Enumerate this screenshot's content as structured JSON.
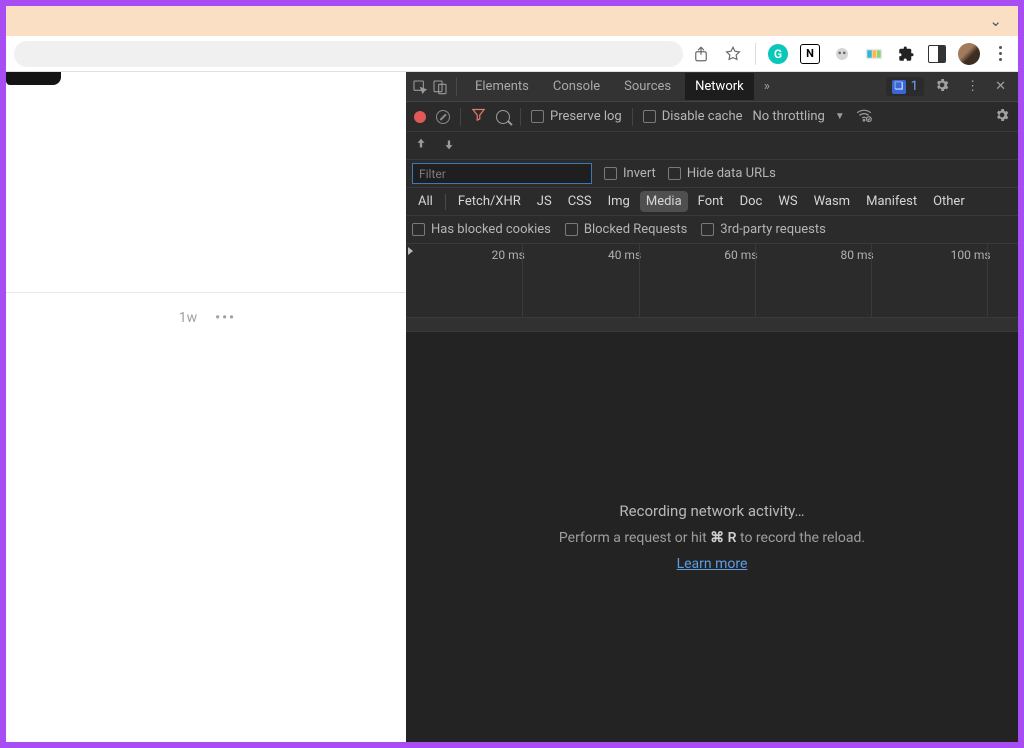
{
  "browser": {
    "share_label": "Share",
    "star_label": "Bookmark"
  },
  "page": {
    "meta_time": "1w"
  },
  "devtools": {
    "tabs": {
      "elements": "Elements",
      "console": "Console",
      "sources": "Sources",
      "network": "Network"
    },
    "issues_count": "1",
    "toolbar": {
      "preserve_log": "Preserve log",
      "disable_cache": "Disable cache",
      "throttling": "No throttling"
    },
    "filter": {
      "placeholder": "Filter",
      "invert": "Invert",
      "hide_data_urls": "Hide data URLs"
    },
    "types": {
      "all": "All",
      "fetch_xhr": "Fetch/XHR",
      "js": "JS",
      "css": "CSS",
      "img": "Img",
      "media": "Media",
      "font": "Font",
      "doc": "Doc",
      "ws": "WS",
      "wasm": "Wasm",
      "manifest": "Manifest",
      "other": "Other"
    },
    "block_row": {
      "blocked_cookies": "Has blocked cookies",
      "blocked_requests": "Blocked Requests",
      "third_party": "3rd-party requests"
    },
    "timeline": {
      "ticks": [
        "20 ms",
        "40 ms",
        "60 ms",
        "80 ms",
        "100 ms"
      ]
    },
    "empty": {
      "line1": "Recording network activity…",
      "line2_a": "Perform a request or hit ",
      "line2_cmd": "⌘ R",
      "line2_b": " to record the reload.",
      "learn_more": "Learn more"
    }
  }
}
